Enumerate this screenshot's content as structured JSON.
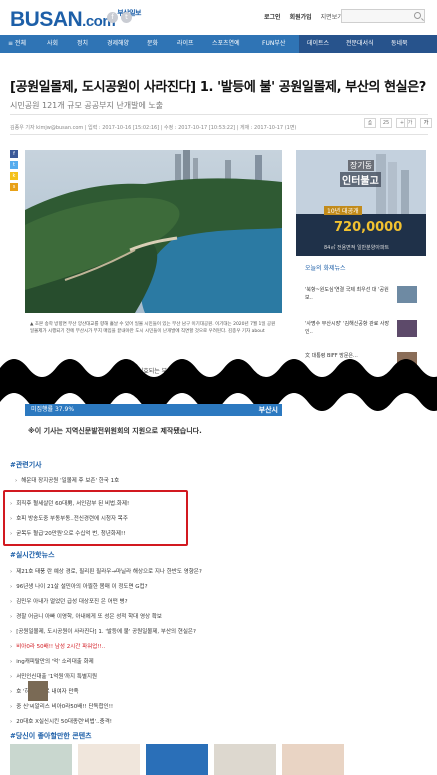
{
  "header": {
    "logo": "BUSAN",
    "logo_dotcom": ".com",
    "logo_small": "부산일보",
    "links": [
      "로그인",
      "회원가입",
      "지면보기"
    ],
    "search_placeholder": ""
  },
  "nav": {
    "items": [
      "≡ 전체",
      "사회",
      "정치",
      "경제해양",
      "문화",
      "라이프",
      "스포츠연예",
      "FUN부산"
    ],
    "right_items": [
      "데이트스",
      "전문대서식",
      "동네북"
    ]
  },
  "article": {
    "title": "[공원일몰제, 도시공원이 사라진다] 1. '발등에 불' 공원일몰제, 부산의 현실은?",
    "subtitle": "시민공원 121개 규모 공공부지 난개발에 노출",
    "meta": "김종우 기자 kimjw@busan.com  |  입력 : 2017-10-16 [15:02:16]  |  수정 : 2017-10-17 [10:53:22]  |  게재 : 2017-10-17 (1면)",
    "tools": [
      "⎙",
      "25",
      "+",
      "가",
      "가"
    ],
    "caption": "▲ 초본 송학 방향면 부산 양산대교를 향해 흘날 수 있어 일몰 시민들이 있는 부산 남구 이기대공원. 이기대는 2020년 7월 1일 공원일몰제가 시행되기 전에 부산시가 부지 매입을 끝내야만 도시 시민들이 난개발에 직면할 것으로 우려된다. 김종우 기자 about",
    "banner_left": "미집행률 37.9%",
    "banner_right": "부산시",
    "note": "※이 기사는 지역신문발전위원회의 지원으로 제작됐습니다.",
    "partial_text": "2020년                        실효되는 부"
  },
  "ad": {
    "line1": "장기동",
    "line2": "인터불고",
    "line3": "10년 대공개",
    "price": "720,0000",
    "footer": "84㎡ 전용면적 일반분양아파트"
  },
  "sidebar": {
    "title": "오늘의 화제뉴스",
    "items": [
      "'북항~원도심'연결 국제 최우선 대 '공원보..",
      "'사명수 부산시장' '김해신공항 관료 사장인..",
      "文 대통령 BIFF 방문은..."
    ]
  },
  "related": {
    "title": "#관련기사",
    "items": [
      "해운대 장지공원 '일몰제 후 보존' 한국 1호"
    ]
  },
  "highlighted": {
    "items": [
      "회직후 혈세살던 60대男, 서인감부 된 비법.화제!",
      "호피 방송도중 부동부동..전신경련에 시청자 목주",
      "굳목두 혈급'20만원'으로 수십억 번, 청년화제!!"
    ]
  },
  "realtime": {
    "title": "#실시간핫뉴스",
    "items": [
      "제21호 태풍 란 예상 경로, 필리핀 필라우→마닐라 해상으로 지나 한반도 영향은?",
      "96년생 나이 21살 설민아의 아찔한 몸매 이 정도면 G컵?",
      "김민우 아내가 얼었던 급성 대상포진 은 어떤 병?",
      "경찰 어금니 아빠 이영학, 아내에게 또 성은 성적 학대 영상 확보",
      "[공원일몰제, 도시공원이 사라진다] 1. '발등에 불' 공원일몰제, 부산의 현실은?",
      "비아0라 50배!! 남성 2시간 파워업!!..",
      "ing캐피탈만의 '억' 소리대출 화제",
      "서민인신대출 '1억원'까지 특별지원",
      "호       '하루1알'로 내여자 만족",
      "중    신'씨알리스 비아0라50배!! 단독합인!!",
      "20대호 X실신시킨 50대종련'비법'..충격!"
    ],
    "red_index": 5
  },
  "recommend": {
    "title": "#당신이 좋아할만한 콘텐츠"
  },
  "colors": {
    "brand": "#1d5fa8",
    "nav": "#2f74b5",
    "highlight_border": "#d21920"
  }
}
